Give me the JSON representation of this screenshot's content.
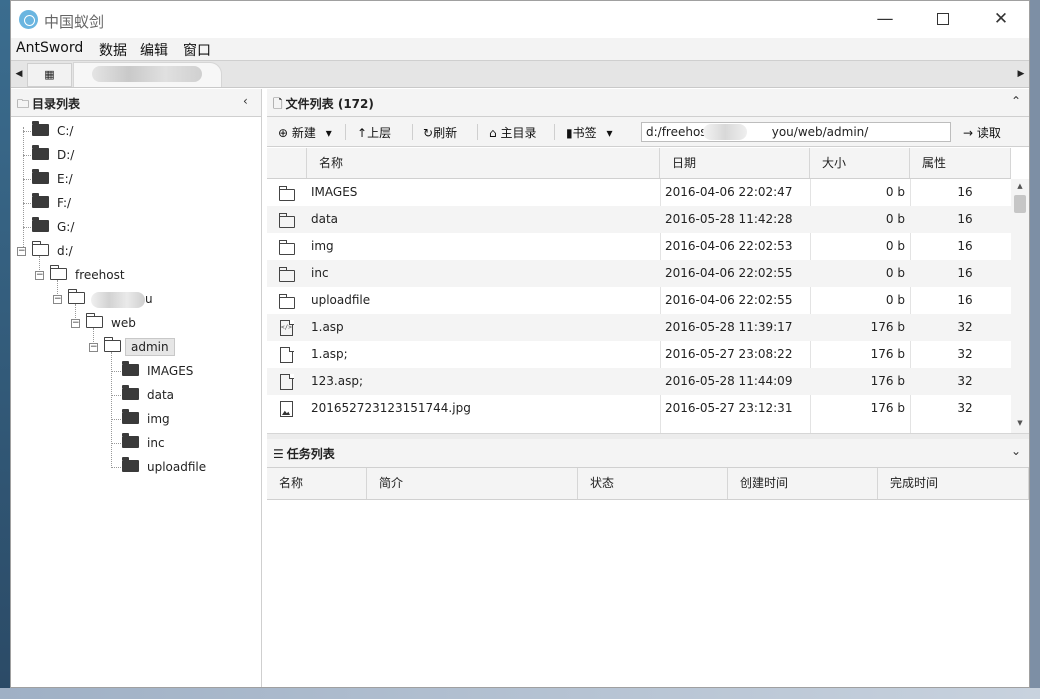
{
  "window": {
    "title": "中国蚁剑",
    "minimize_glyph": "—",
    "close_glyph": "✕"
  },
  "menu": [
    "AntSword",
    "数据",
    "编辑",
    "窗口"
  ],
  "tabs": {
    "left_arrow": "◀",
    "right_arrow": "▶",
    "home_glyph": "▦"
  },
  "dir_panel": {
    "title": "目录列表",
    "collapse_glyph": "‹",
    "tree": [
      {
        "label": "C:/"
      },
      {
        "label": "D:/"
      },
      {
        "label": "E:/"
      },
      {
        "label": "F:/"
      },
      {
        "label": "G:/"
      },
      {
        "label": "d:/"
      },
      {
        "label": "freehost"
      },
      {
        "label": "u"
      },
      {
        "label": "web"
      },
      {
        "label": "admin"
      },
      {
        "label": "IMAGES"
      },
      {
        "label": "data"
      },
      {
        "label": "img"
      },
      {
        "label": "inc"
      },
      {
        "label": "uploadfile"
      }
    ]
  },
  "file_panel": {
    "title": "文件列表 (172)",
    "collapse_glyph": "⌃",
    "toolbar": {
      "new_label": "新建",
      "up_label": "上层",
      "refresh_label": "刷新",
      "home_label": "主目录",
      "bookmark_label": "书签",
      "path_value": "d:/freehost/ya           you/web/admin/",
      "read_label": "读取"
    },
    "columns": [
      "名称",
      "日期",
      "大小",
      "属性"
    ],
    "rows": [
      {
        "icon": "folder",
        "name": "IMAGES",
        "date": "2016-04-06 22:02:47",
        "size": "0 b",
        "attr": "16"
      },
      {
        "icon": "folder",
        "name": "data",
        "date": "2016-05-28 11:42:28",
        "size": "0 b",
        "attr": "16"
      },
      {
        "icon": "folder",
        "name": "img",
        "date": "2016-04-06 22:02:53",
        "size": "0 b",
        "attr": "16"
      },
      {
        "icon": "folder",
        "name": "inc",
        "date": "2016-04-06 22:02:55",
        "size": "0 b",
        "attr": "16"
      },
      {
        "icon": "folder",
        "name": "uploadfile",
        "date": "2016-04-06 22:02:55",
        "size": "0 b",
        "attr": "16"
      },
      {
        "icon": "code-file",
        "name": "1.asp",
        "date": "2016-05-28 11:39:17",
        "size": "176 b",
        "attr": "32"
      },
      {
        "icon": "file",
        "name": "1.asp;",
        "date": "2016-05-27 23:08:22",
        "size": "176 b",
        "attr": "32"
      },
      {
        "icon": "file",
        "name": "123.asp;",
        "date": "2016-05-28 11:44:09",
        "size": "176 b",
        "attr": "32"
      },
      {
        "icon": "image-file",
        "name": "201652723123151744.jpg",
        "date": "2016-05-27 23:12:31",
        "size": "176 b",
        "attr": "32"
      }
    ]
  },
  "task_panel": {
    "title": "任务列表",
    "collapse_glyph": "⌄",
    "columns": [
      "名称",
      "简介",
      "状态",
      "创建时间",
      "完成时间"
    ]
  }
}
